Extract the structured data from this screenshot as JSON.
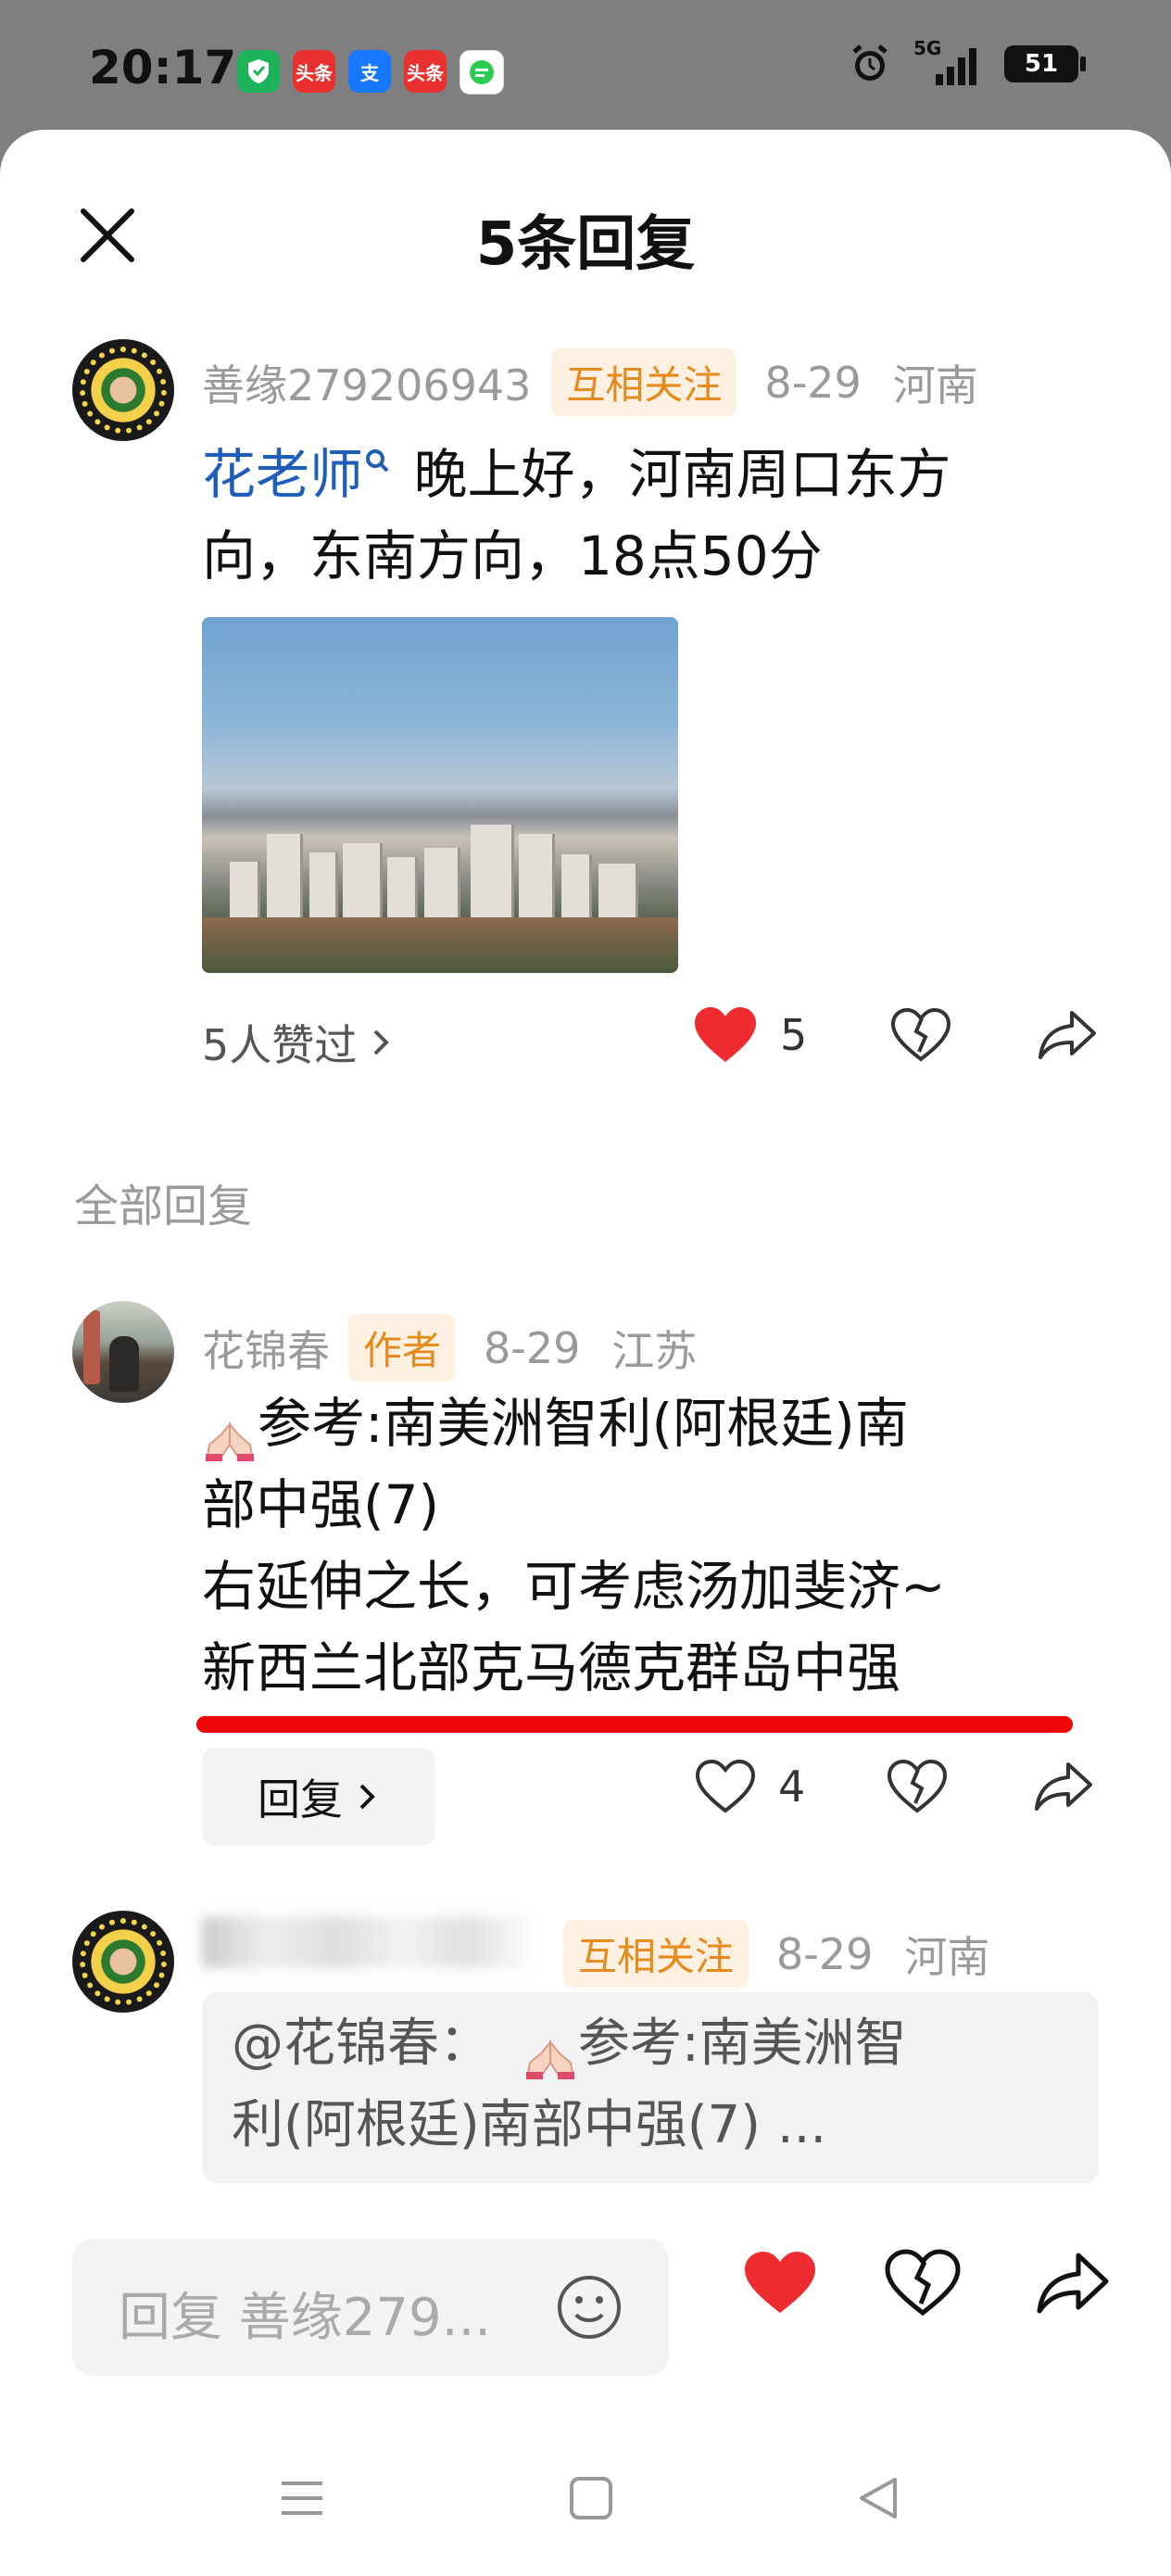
{
  "status_bar": {
    "time": "20:17",
    "app_icons": [
      {
        "name": "shield-app-icon",
        "label": "",
        "color": "#1db35b"
      },
      {
        "name": "toutiao-app-icon",
        "label": "头条",
        "color": "#e9312f"
      },
      {
        "name": "alipay-app-icon",
        "label": "支",
        "color": "#1677ff"
      },
      {
        "name": "toutiao-lite-app-icon",
        "label": "头条",
        "color": "#e9312f"
      },
      {
        "name": "message-app-icon",
        "label": "",
        "color": "#2ecb52"
      }
    ],
    "network": "5G",
    "battery": "51"
  },
  "header": {
    "title": "5条回复"
  },
  "main_comment": {
    "author": "善缘279206943",
    "tag": "互相关注",
    "date": "8-29",
    "location": "河南",
    "mention": "花老师",
    "text_line1": "晚上好，河南周口东方",
    "text_line2": "向，东南方向，18点50分",
    "likes_summary": "5人赞过",
    "like_count": "5"
  },
  "section_label": "全部回复",
  "replies": [
    {
      "author": "花锦春",
      "tag": "作者",
      "date": "8-29",
      "location": "江苏",
      "line1": "参考:南美洲智利(阿根廷)南",
      "line2": "部中强(7)",
      "line3": "右延伸之长，可考虑汤加斐济~",
      "line4": "新西兰北部克马德克群岛中强",
      "reply_button": "回复",
      "like_count": "4"
    },
    {
      "tag": "互相关注",
      "date": "8-29",
      "location": "河南",
      "quote_line1": "@花锦春：",
      "quote_line1b": "参考:南美洲智",
      "quote_line2": "利(阿根廷)南部中强(7) ..."
    }
  ],
  "bottom_bar": {
    "reply_placeholder": "回复 善缘279..."
  },
  "colors": {
    "accent_red": "#ee2b2f",
    "mention_blue": "#1e5db8",
    "tag_orange": "#e58a1c"
  }
}
